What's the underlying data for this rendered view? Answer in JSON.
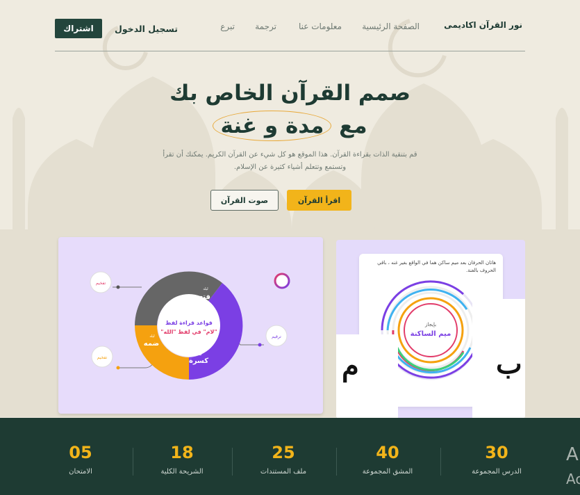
{
  "header": {
    "brand": "نور القرآن اكاديمى",
    "nav": [
      "الصفحة الرئيسية",
      "معلومات عنا",
      "ترجمة",
      "تبرع"
    ],
    "login_label": "تسجيل الدخول",
    "subscribe_label": "اشتراك"
  },
  "hero": {
    "title_line1": "صمم القرآن الخاص بك",
    "title_line2_prefix": "مع",
    "title_line2_highlight": "مدة و غنة",
    "subtitle_line1": "قم بتنقية الذات بقراءة القرآن. هذا الموقع هو كل شيء عن القرآن الكريم. يمكنك أن تقرأ",
    "subtitle_line2": "وتستمع وتتعلم أشياء كثيرة عن الإسلام."
  },
  "buttons": {
    "read": "اقرأ القرآن",
    "audio": "صوت القرآن"
  },
  "left_card": {
    "center_line1": "قواعد قراءة لفظ",
    "center_line2": "\"لام\" في لفظ \"الله\"",
    "seg_fatha_small": "ليله",
    "seg_fatha": "فتح",
    "seg_kasra_small": "ليله",
    "seg_kasra": "كسرة",
    "seg_damma_small": "ليله",
    "seg_damma": "ضمه",
    "chip_top_left": "تفخيم",
    "chip_bottom_left": "تفخيم",
    "chip_right": "ترقيم",
    "colors": {
      "fatha": "#666666",
      "kasra": "#7b3fe4",
      "damma": "#f5a10f",
      "accent": "#e23c6a"
    }
  },
  "right_card": {
    "tooltip": "هاتان الحرفان بعد ميم ساكن هما في الواقع بغير غنه ، باقي الحروف بالغنة.",
    "small_label": "بإيجاز",
    "title": "ميم الساكنة",
    "letter_left": "م",
    "letter_right": "ب"
  },
  "stats": [
    {
      "value": "30",
      "label": "الدرس المجموعة"
    },
    {
      "value": "40",
      "label": "المشق المجموعة"
    },
    {
      "value": "25",
      "label": "ملف المستندات"
    },
    {
      "value": "18",
      "label": "الشريحة الكلية"
    },
    {
      "value": "05",
      "label": "الامتحان"
    }
  ],
  "partial_text": {
    "line1": "A",
    "line2": "Ac"
  }
}
